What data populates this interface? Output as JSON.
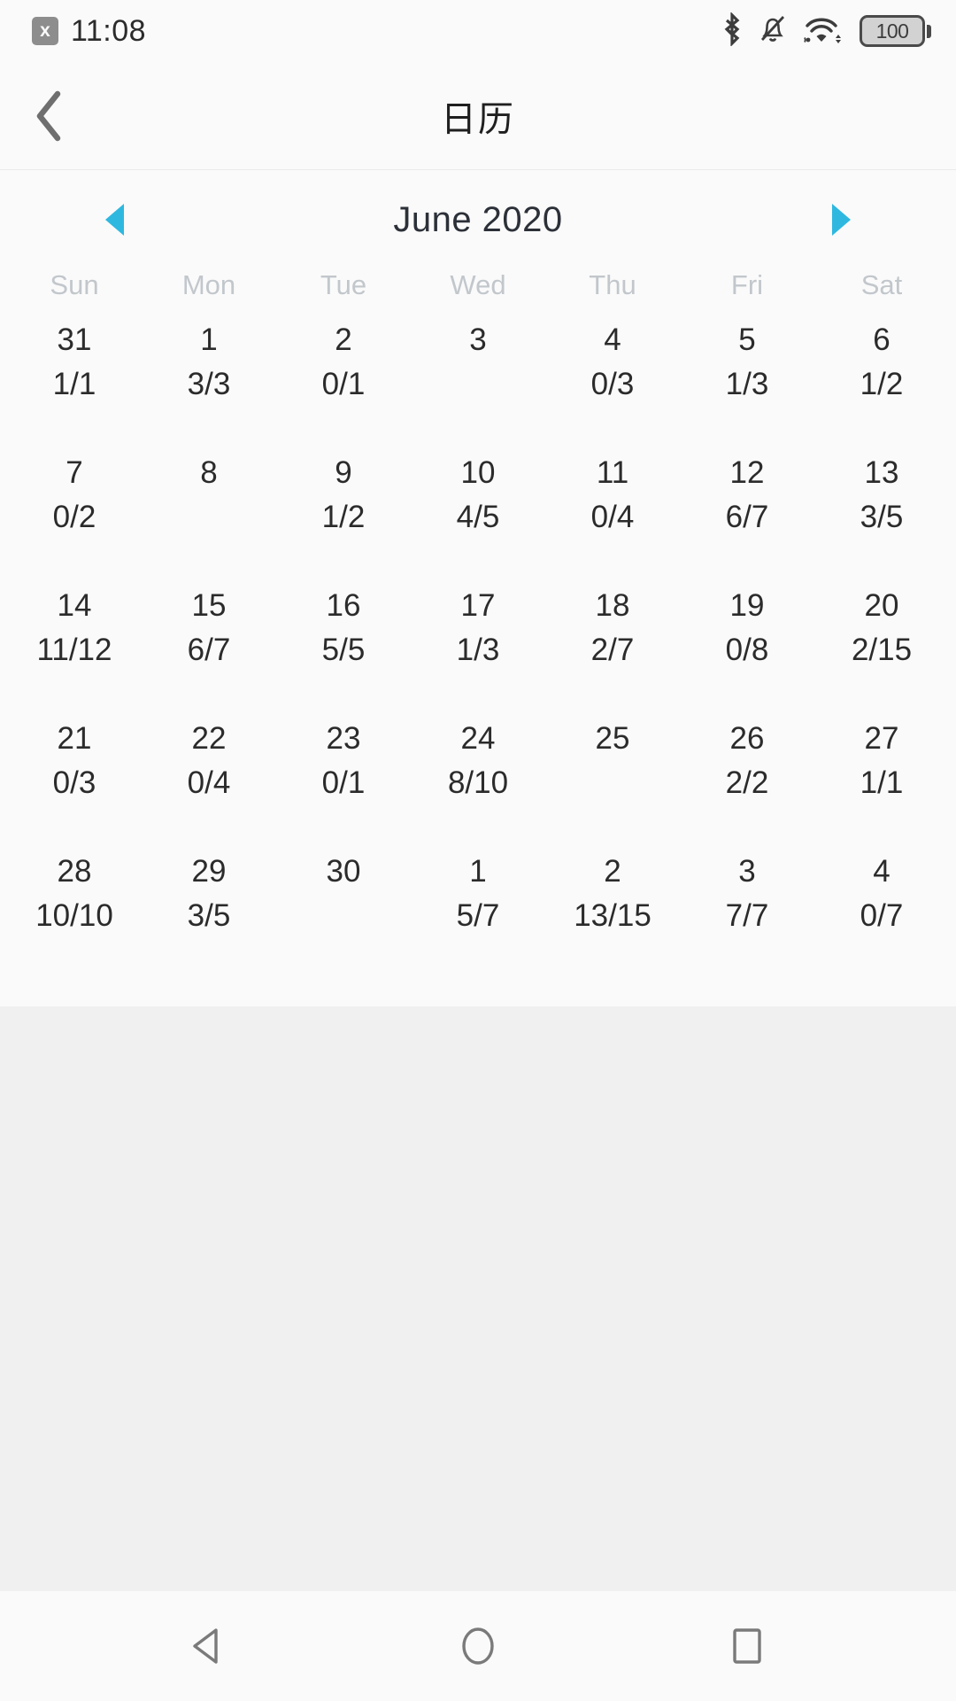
{
  "status_bar": {
    "notification_badge": "x",
    "time": "11:08",
    "icons": [
      "bluetooth-icon",
      "notifications-muted-icon",
      "wifi-icon"
    ],
    "battery_level": "100"
  },
  "app_bar": {
    "back_label": "back-chevron-icon",
    "title": "日历"
  },
  "calendar": {
    "prev_label": "◀",
    "next_label": "▶",
    "month_label": "June 2020",
    "accent_color": "#2EB8E0",
    "weekdays": [
      "Sun",
      "Mon",
      "Tue",
      "Wed",
      "Thu",
      "Fri",
      "Sat"
    ],
    "weeks": [
      [
        {
          "day": "31",
          "sub": "1/1"
        },
        {
          "day": "1",
          "sub": "3/3"
        },
        {
          "day": "2",
          "sub": "0/1"
        },
        {
          "day": "3",
          "sub": ""
        },
        {
          "day": "4",
          "sub": "0/3"
        },
        {
          "day": "5",
          "sub": "1/3"
        },
        {
          "day": "6",
          "sub": "1/2"
        }
      ],
      [
        {
          "day": "7",
          "sub": "0/2"
        },
        {
          "day": "8",
          "sub": ""
        },
        {
          "day": "9",
          "sub": "1/2"
        },
        {
          "day": "10",
          "sub": "4/5"
        },
        {
          "day": "11",
          "sub": "0/4"
        },
        {
          "day": "12",
          "sub": "6/7"
        },
        {
          "day": "13",
          "sub": "3/5"
        }
      ],
      [
        {
          "day": "14",
          "sub": "11/12"
        },
        {
          "day": "15",
          "sub": "6/7"
        },
        {
          "day": "16",
          "sub": "5/5"
        },
        {
          "day": "17",
          "sub": "1/3"
        },
        {
          "day": "18",
          "sub": "2/7"
        },
        {
          "day": "19",
          "sub": "0/8"
        },
        {
          "day": "20",
          "sub": "2/15"
        }
      ],
      [
        {
          "day": "21",
          "sub": "0/3"
        },
        {
          "day": "22",
          "sub": "0/4"
        },
        {
          "day": "23",
          "sub": "0/1"
        },
        {
          "day": "24",
          "sub": "8/10"
        },
        {
          "day": "25",
          "sub": ""
        },
        {
          "day": "26",
          "sub": "2/2"
        },
        {
          "day": "27",
          "sub": "1/1"
        }
      ],
      [
        {
          "day": "28",
          "sub": "10/10"
        },
        {
          "day": "29",
          "sub": "3/5"
        },
        {
          "day": "30",
          "sub": ""
        },
        {
          "day": "1",
          "sub": "5/7"
        },
        {
          "day": "2",
          "sub": "13/15"
        },
        {
          "day": "3",
          "sub": "7/7"
        },
        {
          "day": "4",
          "sub": "0/7"
        }
      ]
    ]
  },
  "nav_bar": {
    "back": "back-triangle-icon",
    "home": "home-circle-icon",
    "recents": "recents-square-icon"
  }
}
